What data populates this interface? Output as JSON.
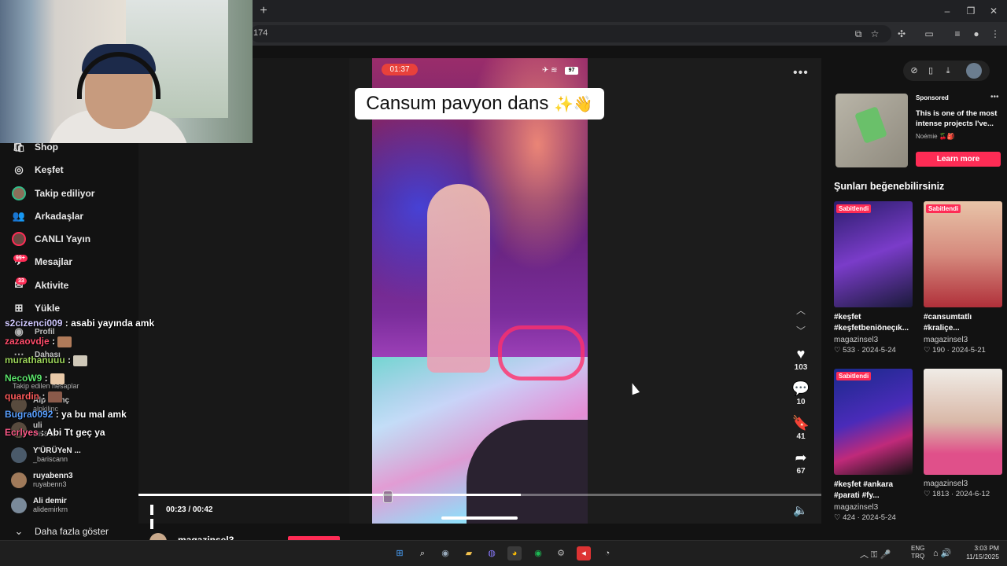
{
  "browser": {
    "new_tab": "+",
    "window_controls": [
      "–",
      "❐",
      "✕"
    ],
    "url": "174"
  },
  "sidebar": {
    "items": [
      {
        "label": "Shop",
        "icon": "shop-icon"
      },
      {
        "label": "Keşfet",
        "icon": "compass-icon"
      },
      {
        "label": "Takip ediliyor",
        "icon": "avatar-icon"
      },
      {
        "label": "Arkadaşlar",
        "icon": "friends-icon"
      },
      {
        "label": "CANLI Yayın",
        "icon": "live-icon"
      },
      {
        "label": "Mesajlar",
        "icon": "messages-icon",
        "badge": "99+"
      },
      {
        "label": "Aktivite",
        "icon": "activity-icon",
        "badge": "33"
      },
      {
        "label": "Yükle",
        "icon": "upload-icon"
      },
      {
        "label": "Profil",
        "icon": "profile-icon"
      },
      {
        "label": "Dahası",
        "icon": "more-icon"
      }
    ],
    "following_header": "Takip edilen hesaplar",
    "following": [
      {
        "name": "Alp Kılınç",
        "handle": "alpkilinc"
      },
      {
        "name": "uli",
        "handle": "uli5845"
      },
      {
        "name": "Y'ÜRÜYeN ...",
        "handle": "_bariscann"
      },
      {
        "name": "ruyabenn3",
        "handle": "ruyabenn3"
      },
      {
        "name": "Ali demir",
        "handle": "alidemirkrn"
      }
    ],
    "show_more": "Daha fazla göster"
  },
  "chat": [
    {
      "user": "s2cizenci009",
      "user_color": "#d0c8ff",
      "message": "asabi yayında amk",
      "emote": false
    },
    {
      "user": "zazaovdje",
      "user_color": "#ff4d6b",
      "message": "",
      "emote": true
    },
    {
      "user": "murathanuuu",
      "user_color": "#9bd35a",
      "message": "",
      "emote": true
    },
    {
      "user": "NecoW9",
      "user_color": "#5be36b",
      "message": "",
      "emote": true
    },
    {
      "user": "quardin",
      "user_color": "#ff5b5b",
      "message": "",
      "emote": true
    },
    {
      "user": "Bugra0092",
      "user_color": "#5aa0ff",
      "message": "ya bu mal amk",
      "emote": false
    },
    {
      "user": "Ecrlyes",
      "user_color": "#ff5b8a",
      "message": "Abi Tt geç ya",
      "emote": false
    }
  ],
  "video": {
    "phone_time": "01:37",
    "battery": "97",
    "caption": "Cansum pavyon dans",
    "caption_emoji": "✨👋",
    "likes": "103",
    "comments": "10",
    "saves": "41",
    "shares": "67",
    "current_time": "00:23",
    "duration": "00:42",
    "time_separator": " / ",
    "progress_fraction": 0.56,
    "author": "magazinsel3"
  },
  "ad": {
    "sponsored": "Sponsored",
    "title": "This is one of the most intense projects I've...",
    "author": "Noémie 🍒🎒",
    "cta": "Learn more"
  },
  "suggestions": {
    "header": "Şunları beğenebilirsiniz",
    "items": [
      {
        "pinned": "Sabitlendi",
        "title": "#keşfet #keşfetbeniöneçık...",
        "user": "magazinsel3",
        "likes": "533",
        "date": "2024-5-24"
      },
      {
        "pinned": "Sabitlendi",
        "title": "#cansumtatlı #kraliçe...",
        "user": "magazinsel3",
        "likes": "190",
        "date": "2024-5-21"
      },
      {
        "pinned": "Sabitlendi",
        "title": "#keşfet #ankara #parati #fy...",
        "user": "magazinsel3",
        "likes": "424",
        "date": "2024-5-24"
      },
      {
        "pinned": "",
        "title": "",
        "user": "magazinsel3",
        "likes": "1813",
        "date": "2024-6-12"
      }
    ]
  },
  "taskbar": {
    "lang_top": "ENG",
    "lang_bottom": "TRQ",
    "time": "3:03 PM",
    "date": "11/15/2025"
  },
  "colors": {
    "accent": "#fe2c55",
    "background": "#121212"
  }
}
